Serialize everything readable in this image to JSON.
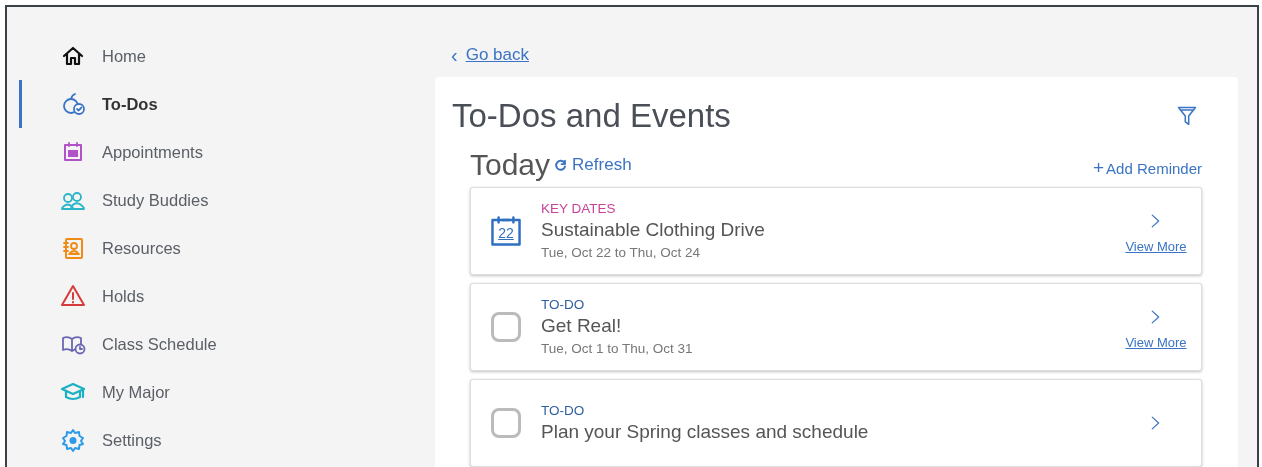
{
  "sidebar": {
    "items": [
      {
        "label": "Home",
        "selected": false
      },
      {
        "label": "To-Dos",
        "selected": true
      },
      {
        "label": "Appointments",
        "selected": false
      },
      {
        "label": "Study Buddies",
        "selected": false
      },
      {
        "label": "Resources",
        "selected": false
      },
      {
        "label": "Holds",
        "selected": false
      },
      {
        "label": "Class Schedule",
        "selected": false
      },
      {
        "label": "My Major",
        "selected": false
      },
      {
        "label": "Settings",
        "selected": false
      }
    ]
  },
  "back_link": {
    "icon": "‹",
    "label": "Go back"
  },
  "panel": {
    "title": "To-Dos and Events",
    "section": "Today",
    "refresh": "Refresh",
    "add_reminder": {
      "icon": "+",
      "label": "Add Reminder"
    },
    "items": [
      {
        "kind": "key_date",
        "category": "KEY DATES",
        "color": "#c8439a",
        "icon_text": "22",
        "title": "Sustainable Clothing Drive",
        "dates": "Tue, Oct 22 to Thu, Oct 24",
        "link": "View More"
      },
      {
        "kind": "todo",
        "category": "TO-DO",
        "color": "#2f5f9e",
        "checked": false,
        "title": "Get Real!",
        "dates": "Tue, Oct 1 to Thu, Oct 31",
        "link": "View More"
      },
      {
        "kind": "todo",
        "category": "TO-DO",
        "color": "#2f5f9e",
        "checked": false,
        "title": "Plan your Spring classes and schedule"
      }
    ]
  }
}
